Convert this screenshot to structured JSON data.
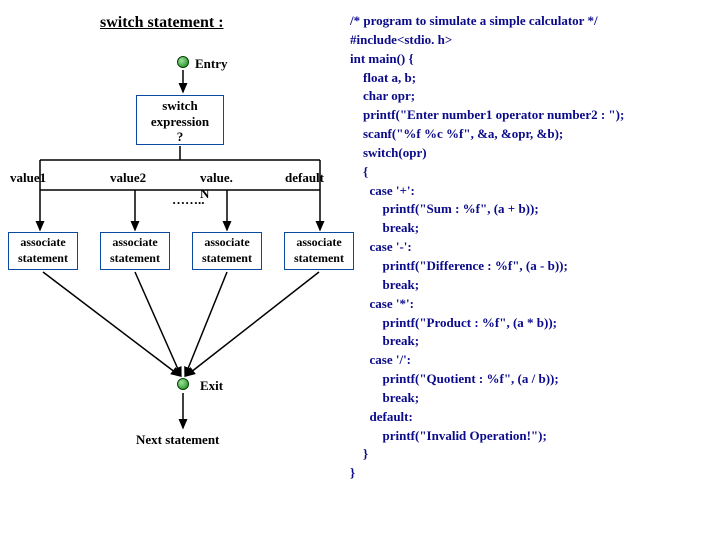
{
  "title": "switch  statement  :",
  "entry": "Entry",
  "switch_lines": {
    "l1": "switch",
    "l2": "expression",
    "l3": "?"
  },
  "values": {
    "v1": "value1",
    "v2": "value2",
    "vN": "value. N",
    "default": "default"
  },
  "dots": "……..",
  "assoc": {
    "l1": "associate",
    "l2": "statement"
  },
  "exit": "Exit",
  "next": "Next statement",
  "code": "/* program to simulate a simple calculator */\n#include<stdio. h>\nint main() {\n    float a, b;\n    char opr;\n    printf(\"Enter number1 operator number2 : \");\n    scanf(\"%f %c %f\", &a, &opr, &b);\n    switch(opr)\n    {\n      case '+':\n          printf(\"Sum : %f\", (a + b));\n          break;\n      case '-':\n          printf(\"Difference : %f\", (a - b));\n          break;\n      case '*':\n          printf(\"Product : %f\", (a * b));\n          break;\n      case '/':\n          printf(\"Quotient : %f\", (a / b));\n          break;\n      default:\n          printf(\"Invalid Operation!\");\n    }\n}"
}
